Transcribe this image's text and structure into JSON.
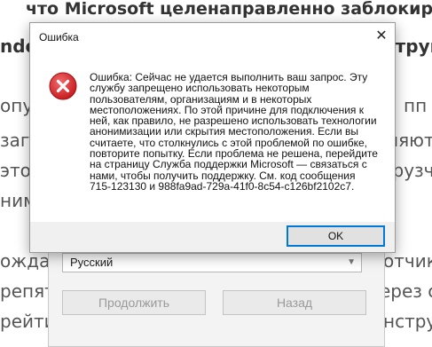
{
  "background": {
    "lines": [
      "что Microsoft целенаправленно заблокировала",
      "ndow",
      "нструм",
      "опул",
      "пп",
      "загр",
      "няют",
      "этом",
      "грузч",
      "ним",
      "ождаю",
      "отчик",
      "репят",
      "ерез ст",
      "рейти",
      "нструм"
    ]
  },
  "installer": {
    "language_value": "Русский",
    "next_label": "Продолжить",
    "back_label": "Назад"
  },
  "dialog": {
    "title": "Ошибка",
    "message": "Ошибка: Сейчас не удается выполнить ваш запрос. Эту\nслужбу запрещено использовать некоторым\nпользователям, организациям и в некоторых\nместоположениях. По этой причине для подключения к\nней, как правило, не разрешено использовать технологии\nанонимизации или скрытия местоположения. Если вы\nсчитаете, что столкнулись с этой проблемой по ошибке,\nповторите попытку. Если проблема не решена, перейдите\nна страницу Служба поддержки Microsoft — связаться с\nнами, чтобы получить поддержку. См. код сообщения\n715-123130 и 988fa9ad-729a-41f0-8c54-c126bf2102c7.",
    "ok_label": "OK",
    "close_glyph": "✕",
    "icon": "error-icon",
    "icon_color": "#d9262b"
  }
}
